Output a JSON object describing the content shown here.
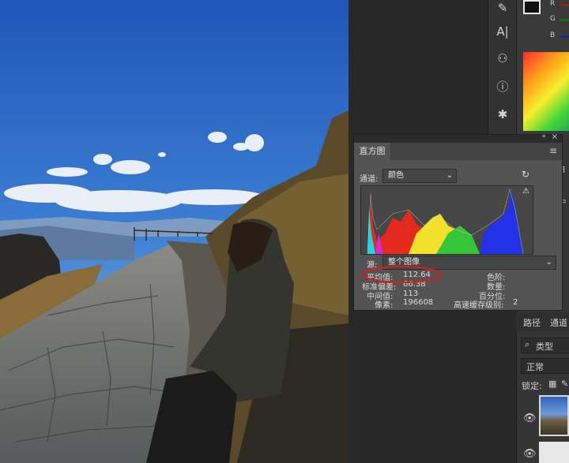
{
  "histogram": {
    "tab_label": "直方图",
    "channel_label": "通道:",
    "channel_value": "颜色",
    "source_label": "源:",
    "source_value": "整个图像",
    "stats_left": [
      {
        "label": "平均值:",
        "value": "112.64"
      },
      {
        "label": "标准偏差:",
        "value": "66.38"
      },
      {
        "label": "中间值:",
        "value": "113"
      },
      {
        "label": "像素:",
        "value": "196608"
      }
    ],
    "stats_right": [
      {
        "label": "色阶:",
        "value": ""
      },
      {
        "label": "数量:",
        "value": ""
      },
      {
        "label": "百分位:",
        "value": ""
      },
      {
        "label": "高速缓存级别:",
        "value": "2"
      }
    ],
    "highlight_color": "#d21f1f"
  },
  "color_panel": {
    "channels": [
      "R",
      "G",
      "B"
    ]
  },
  "layers": {
    "tabs": [
      "路径",
      "通道"
    ],
    "search_label": "类型",
    "blend_mode": "正常",
    "lock_label": "锁定:"
  },
  "tools": [
    "brush-icon",
    "text-icon",
    "stamp-icon",
    "info-icon",
    "compass-icon"
  ]
}
